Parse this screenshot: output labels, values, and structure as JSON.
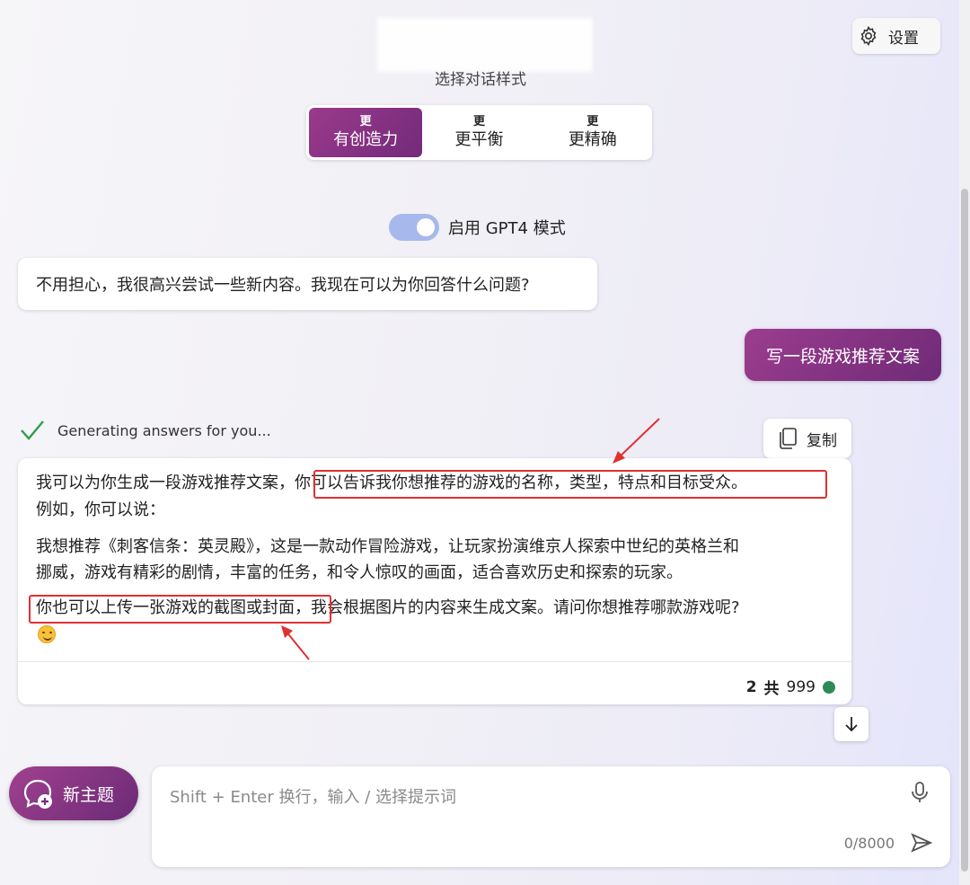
{
  "header": {
    "settings_label": "设置",
    "style_title": "选择对话样式"
  },
  "styles": [
    {
      "small": "更",
      "big": "有创造力",
      "active": true
    },
    {
      "small": "更",
      "big": "更平衡",
      "active": false
    },
    {
      "small": "更",
      "big": "更精确",
      "active": false
    }
  ],
  "gpt4": {
    "label": "启用 GPT4 模式",
    "enabled": true
  },
  "messages": {
    "bot_1": "不用担心，我很高兴尝试一些新内容。我现在可以为你回答什么问题?",
    "user_1": "写一段游戏推荐文案",
    "status": "Generating answers for you...",
    "copy_label": "复制",
    "bot_2": {
      "line1_a": "我可以为你生成一段游戏推荐文案，",
      "line1_b": "你可以告诉我你想推荐的游戏的名称，类型，特点和目标受众。",
      "line2": "例如，你可以说：",
      "line3": "我想推荐《刺客信条：英灵殿》，这是一款动作冒险游戏，让玩家扮演维京人探索中世纪的英格兰和",
      "line4": "挪威，游戏有精彩的剧情，丰富的任务，和令人惊叹的画面，适合喜欢历史和探索的玩家。",
      "line5_a": "你也可以上传一张游戏的截图或封面，",
      "line5_b": "我会根据图片的内容来生成文案。请问你想推荐哪款游戏呢?"
    },
    "turn_count": "2",
    "turn_sep": "共",
    "turn_max": "999"
  },
  "input": {
    "new_topic_label": "新主题",
    "placeholder": "Shift + Enter 换行，输入 / 选择提示词",
    "char_count": "0/8000"
  },
  "colors": {
    "accent": "#7a2b7e",
    "highlight": "#e03030",
    "status_green": "#2e8b57"
  }
}
